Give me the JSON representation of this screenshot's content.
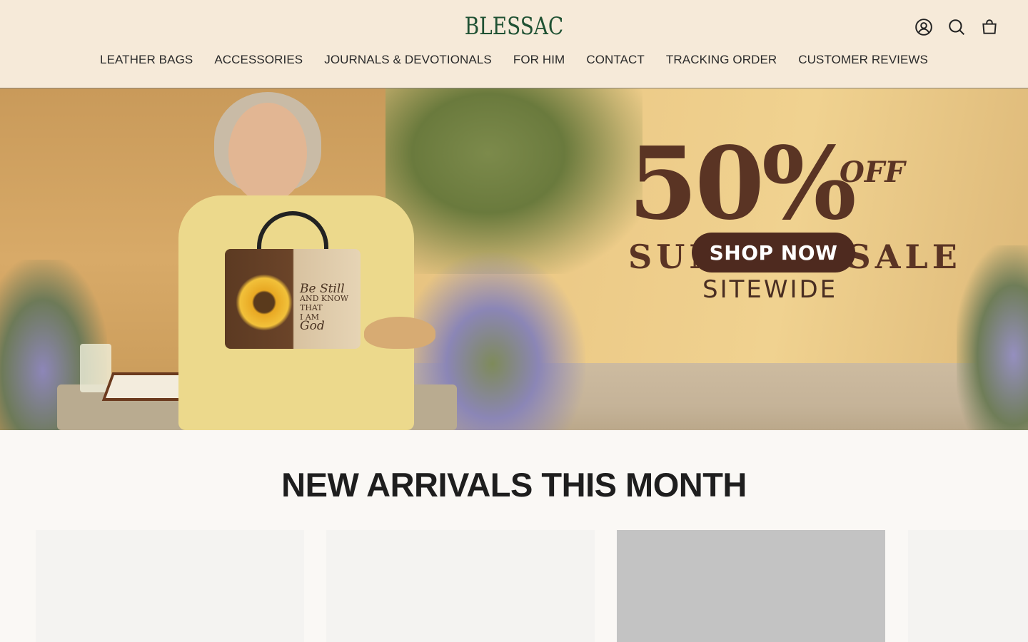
{
  "header": {
    "logo": "BLESSAC",
    "icons": [
      "account-icon",
      "search-icon",
      "cart-icon"
    ],
    "nav": [
      "LEATHER BAGS",
      "ACCESSORIES",
      "JOURNALS & DEVOTIONALS",
      "FOR HIM",
      "CONTACT",
      "TRACKING ORDER",
      "CUSTOMER REVIEWS"
    ]
  },
  "hero": {
    "discount": "50%",
    "off": "OFF",
    "line1": "SUMMER SALE",
    "line2": "SITEWIDE",
    "cta": "SHOP NOW",
    "bag_text": {
      "l1": "Be Still",
      "l2": "AND KNOW",
      "l3": "THAT",
      "l4": "I AM",
      "l5": "God"
    }
  },
  "section": {
    "title": "NEW ARRIVALS THIS MONTH"
  },
  "colors": {
    "header_bg": "#f6ead9",
    "logo": "#1f5133",
    "sale_text": "#5a3424",
    "cta_bg": "#4e2a1f"
  }
}
